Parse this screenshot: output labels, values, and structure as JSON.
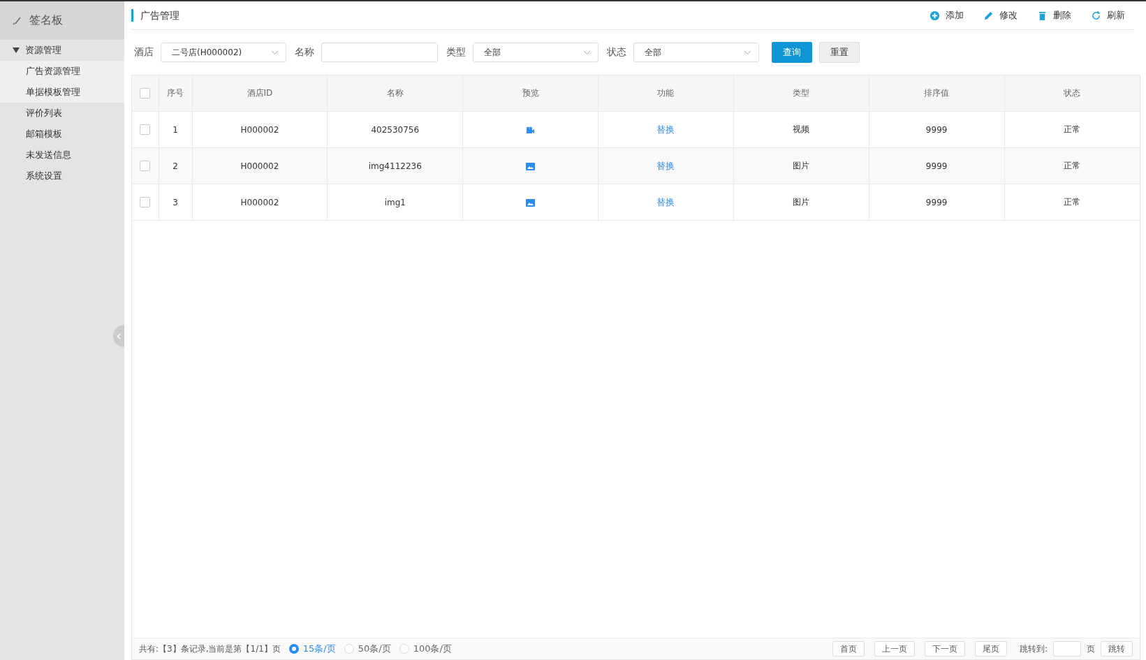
{
  "sidebar": {
    "brand": "签名板",
    "menu": [
      {
        "label": "资源管理",
        "expanded": true,
        "children": [
          {
            "label": "广告资源管理"
          },
          {
            "label": "单据模板管理"
          }
        ]
      },
      {
        "label": "评价列表"
      },
      {
        "label": "邮箱模板"
      },
      {
        "label": "未发送信息"
      },
      {
        "label": "系统设置"
      }
    ]
  },
  "page_title": "广告管理",
  "toolbar": [
    {
      "kind": "add",
      "label": "添加"
    },
    {
      "kind": "edit",
      "label": "修改"
    },
    {
      "kind": "delete",
      "label": "删除"
    },
    {
      "kind": "refresh",
      "label": "刷新"
    }
  ],
  "filters": [
    {
      "kind": "select",
      "label": "酒店",
      "value": "二号店(H000002)"
    },
    {
      "kind": "text",
      "label": "名称"
    },
    {
      "kind": "select",
      "label": "类型",
      "value": "全部"
    },
    {
      "kind": "select",
      "label": "状态",
      "value": "全部"
    }
  ],
  "filter_buttons": [
    {
      "kind": "primary",
      "label": "查询"
    },
    {
      "kind": "default",
      "label": "重置"
    }
  ],
  "table": {
    "select_all_checked": false,
    "columns": [
      "序号",
      "酒店ID",
      "名称",
      "预览",
      "功能",
      "类型",
      "排序值",
      "状态"
    ],
    "rows": [
      {
        "checked": false,
        "index": "1",
        "hotel_id": "H000002",
        "name": "402530756",
        "kind": "video",
        "action": "替换",
        "type": "视频",
        "sort": "9999",
        "status": "正常"
      },
      {
        "checked": false,
        "index": "2",
        "hotel_id": "H000002",
        "name": "img4112236",
        "kind": "image",
        "action": "替换",
        "type": "图片",
        "sort": "9999",
        "status": "正常"
      },
      {
        "checked": false,
        "index": "3",
        "hotel_id": "H000002",
        "name": "img1",
        "kind": "image",
        "action": "替换",
        "type": "图片",
        "sort": "9999",
        "status": "正常"
      }
    ]
  },
  "footer": {
    "summary": "共有:【3】条记录,当前是第【1/1】页",
    "page_sizes": [
      {
        "label": "15条/页",
        "selected": true
      },
      {
        "label": "50条/页",
        "selected": false
      },
      {
        "label": "100条/页",
        "selected": false
      }
    ],
    "pager": [
      "首页",
      "上一页",
      "下一页",
      "尾页"
    ],
    "jump_label": "跳转到:",
    "jump_unit": "页",
    "jump_button": "跳转"
  }
}
